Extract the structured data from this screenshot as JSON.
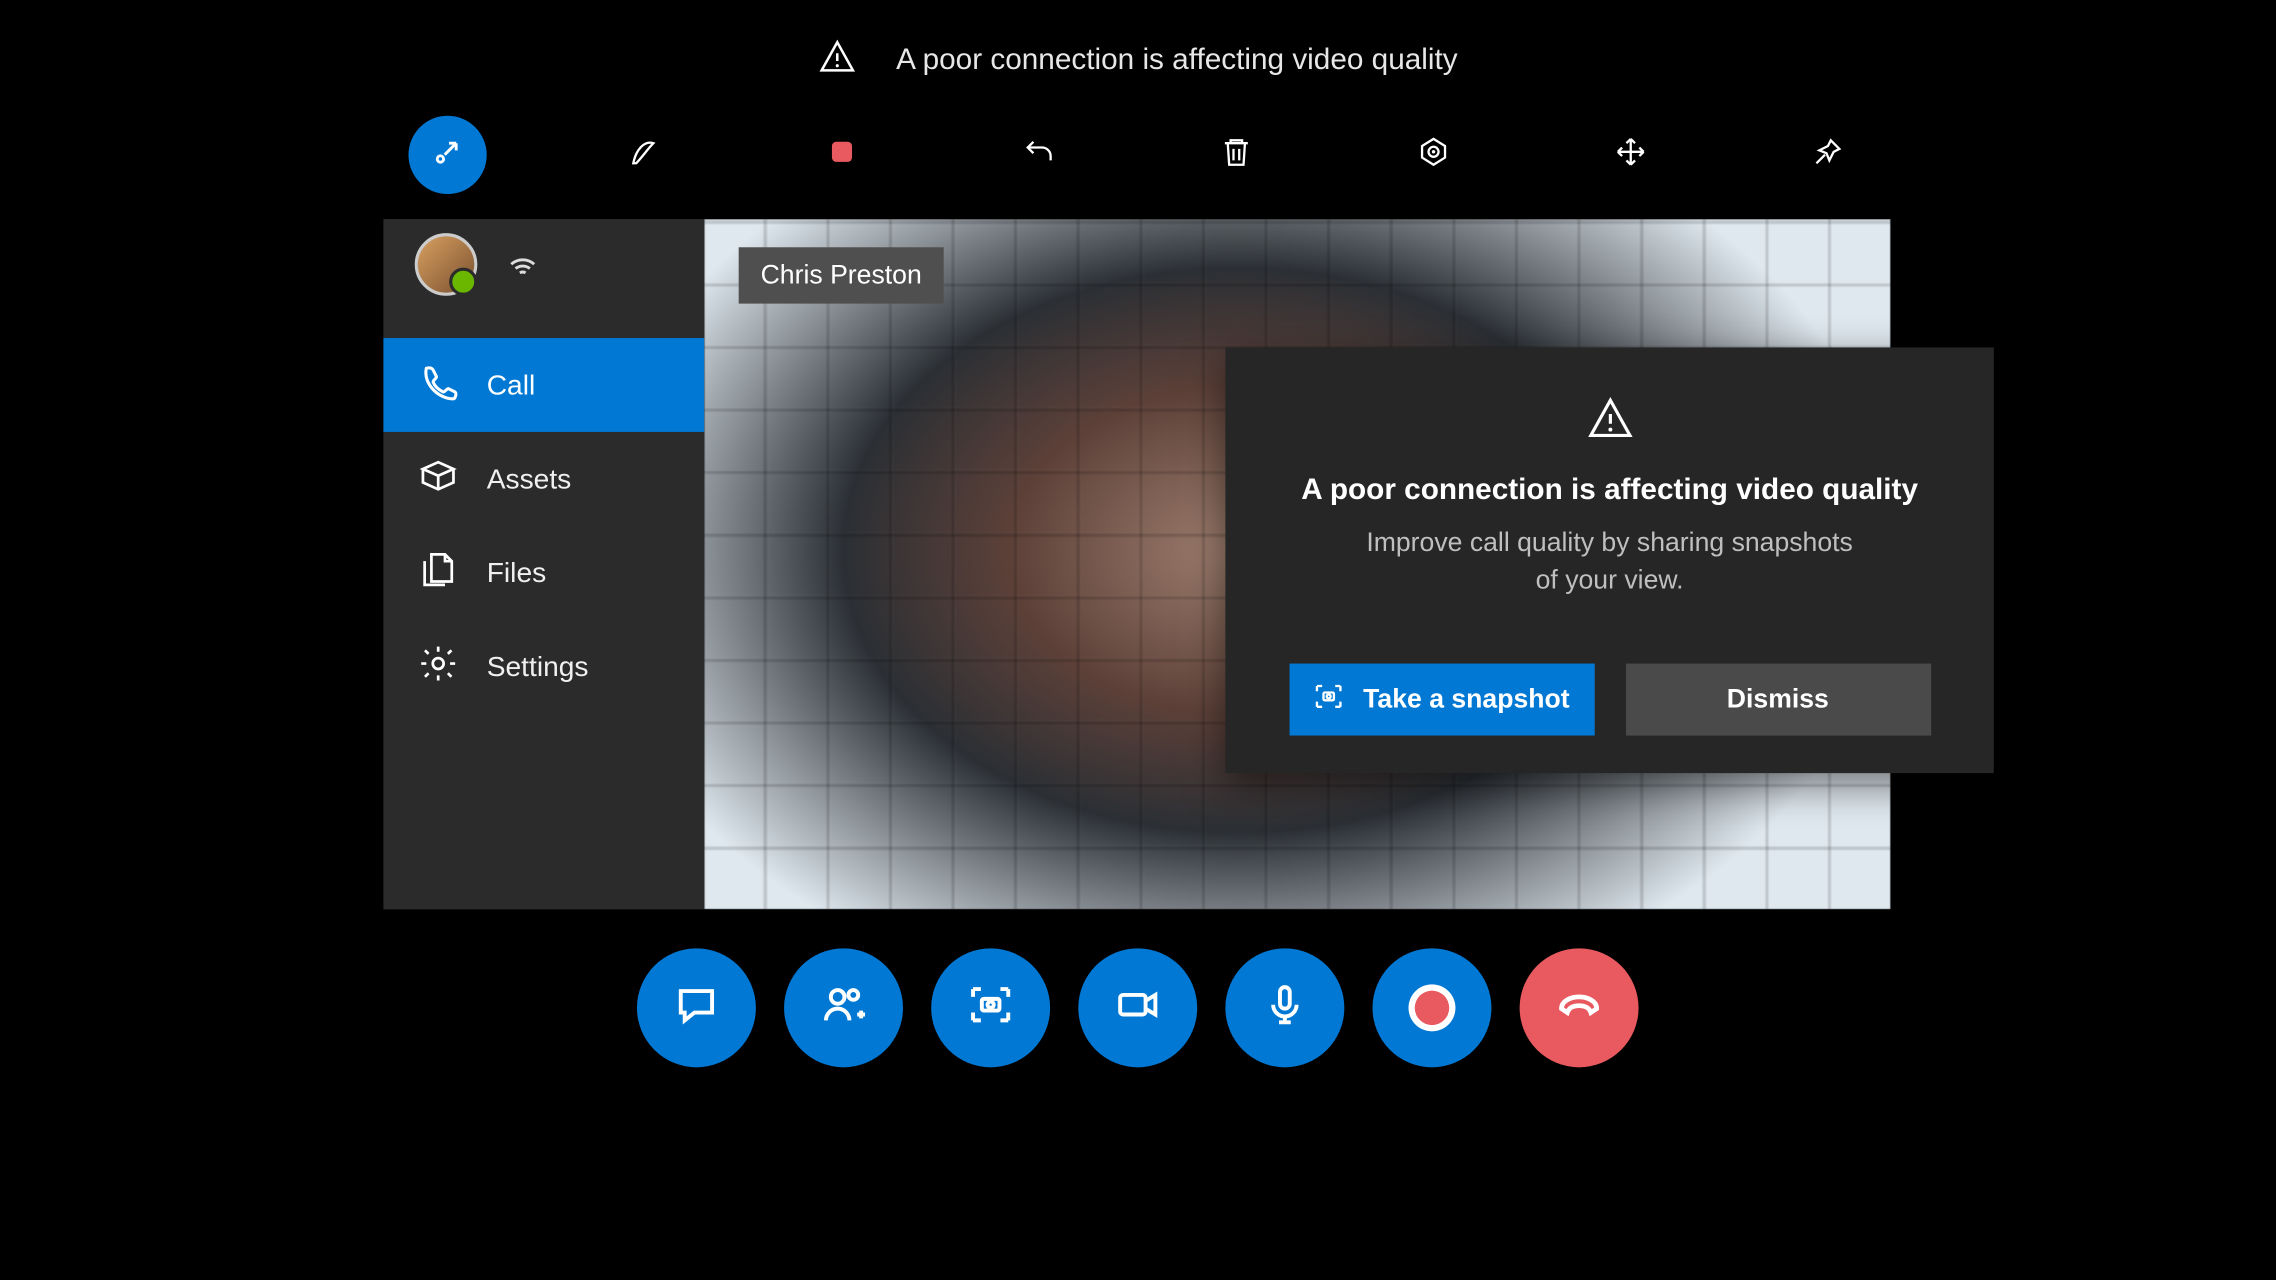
{
  "status_banner": {
    "text": "A poor connection is affecting video quality"
  },
  "toolbar": {
    "items": [
      {
        "id": "collapse-icon",
        "active": true
      },
      {
        "id": "ink-icon",
        "active": false
      },
      {
        "id": "stop-record-icon",
        "active": false
      },
      {
        "id": "undo-icon",
        "active": false
      },
      {
        "id": "delete-icon",
        "active": false
      },
      {
        "id": "detect-icon",
        "active": false
      },
      {
        "id": "move-icon",
        "active": false
      },
      {
        "id": "pin-icon",
        "active": false
      }
    ]
  },
  "sidebar": {
    "items": [
      {
        "id": "call",
        "label": "Call",
        "selected": true
      },
      {
        "id": "assets",
        "label": "Assets",
        "selected": false
      },
      {
        "id": "files",
        "label": "Files",
        "selected": false
      },
      {
        "id": "settings",
        "label": "Settings",
        "selected": false
      }
    ]
  },
  "video": {
    "participant_name": "Chris Preston"
  },
  "dialog": {
    "title": "A poor connection is affecting video quality",
    "body_line1": "Improve call quality by sharing snapshots",
    "body_line2": "of your view.",
    "primary_label": "Take a snapshot",
    "secondary_label": "Dismiss"
  },
  "call_controls": {
    "items": [
      {
        "id": "chat-icon"
      },
      {
        "id": "add-participant-icon"
      },
      {
        "id": "snapshot-icon"
      },
      {
        "id": "video-toggle-icon"
      },
      {
        "id": "mic-toggle-icon"
      },
      {
        "id": "record-icon"
      },
      {
        "id": "hangup-icon"
      }
    ]
  }
}
